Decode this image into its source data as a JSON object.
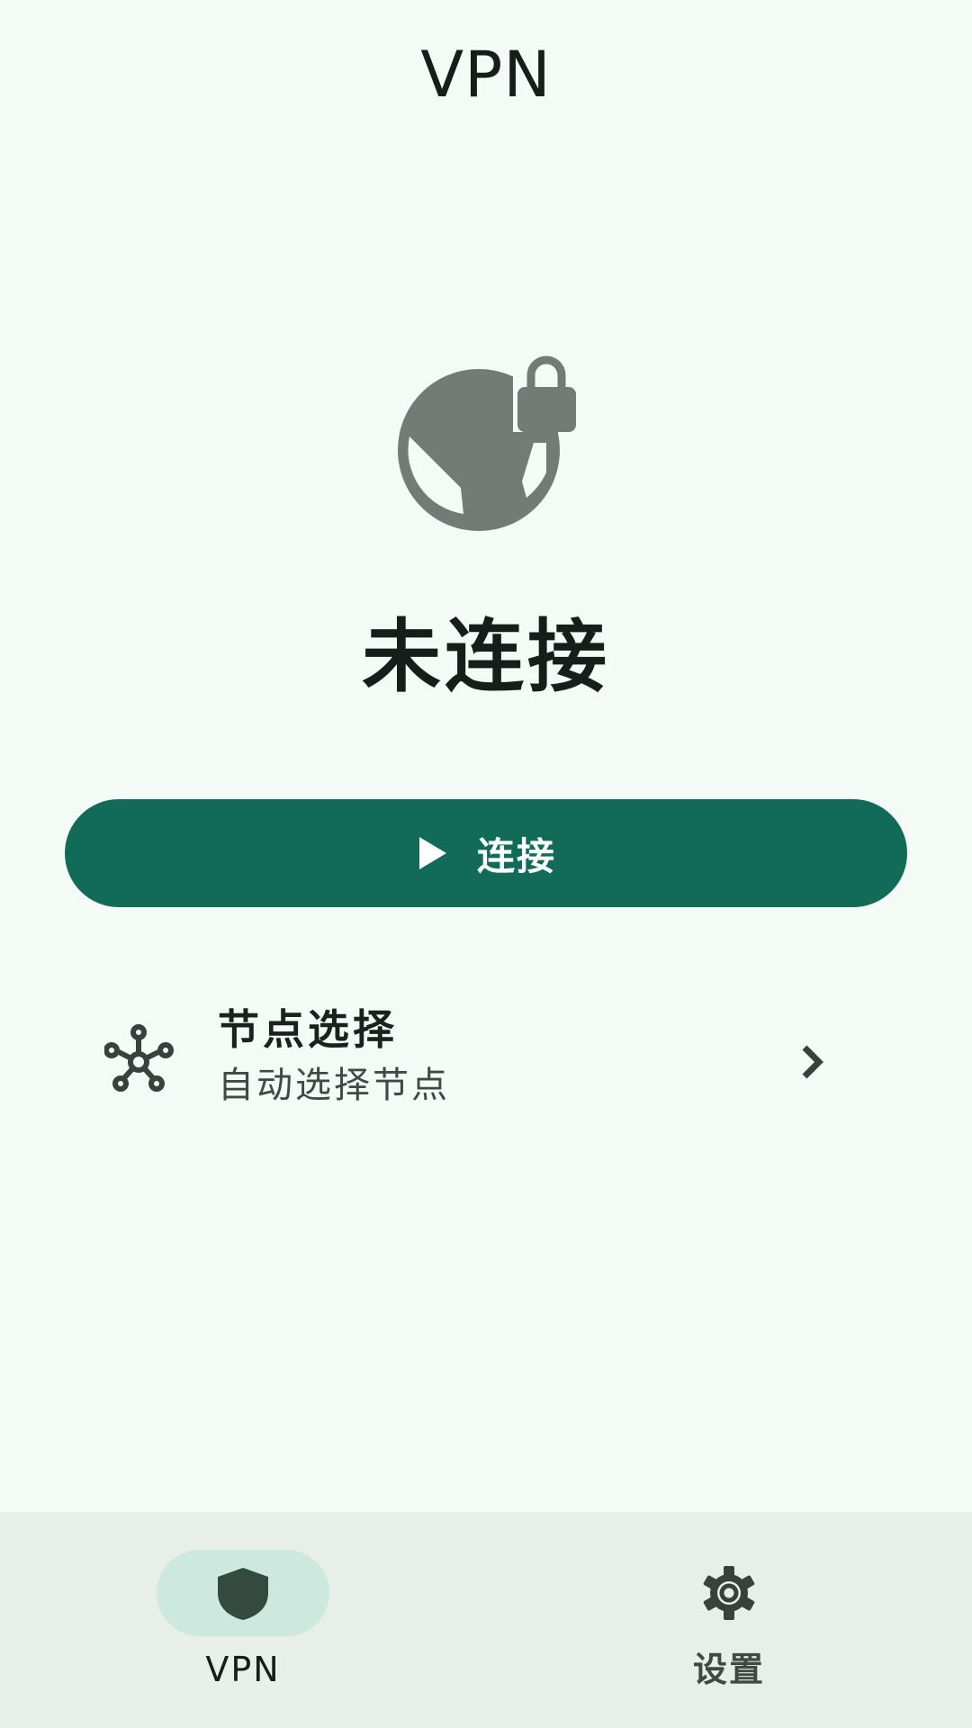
{
  "app_bar": {
    "title": "VPN"
  },
  "status": {
    "icon": "vpn-lock-globe-icon",
    "text": "未连接"
  },
  "connect_button": {
    "icon": "play-icon",
    "label": "连接"
  },
  "node_selection": {
    "icon": "hub-nodes-icon",
    "title": "节点选择",
    "subtitle": "自动选择节点",
    "trailing_icon": "chevron-right-icon"
  },
  "bottom_nav": {
    "items": [
      {
        "label": "VPN",
        "icon": "shield-icon",
        "selected": true
      },
      {
        "label": "设置",
        "icon": "gear-icon",
        "selected": false
      }
    ]
  },
  "colors": {
    "background": "#f4faf6",
    "primary": "#126b58",
    "status_icon": "#737b77",
    "nav_background": "#e8eeea",
    "nav_indicator": "#cde8de"
  }
}
